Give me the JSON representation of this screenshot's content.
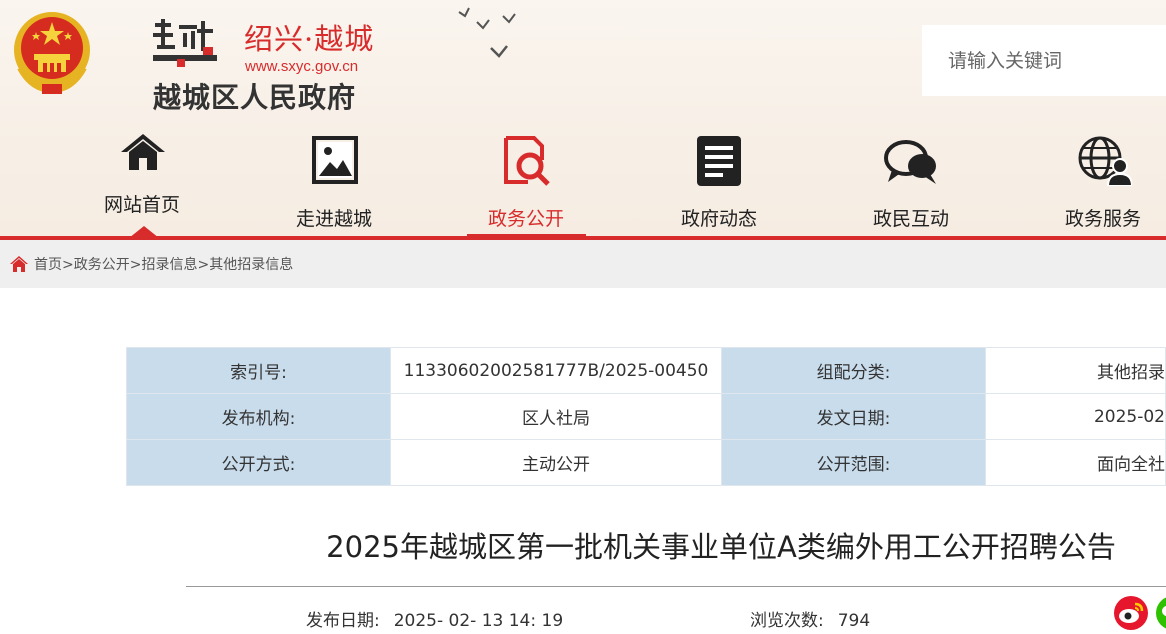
{
  "header": {
    "city_name": "绍兴·越城",
    "url": "www.sxyc.gov.cn",
    "gov_name": "越城区人民政府",
    "logo_mark_icon": "yue-calligraphy-logo",
    "search_placeholder": "请输入关键词"
  },
  "nav": {
    "items": [
      {
        "label": "网站首页",
        "icon": "home-icon"
      },
      {
        "label": "走进越城",
        "icon": "landscape-picture-icon"
      },
      {
        "label": "政务公开",
        "icon": "search-document-icon",
        "active": true
      },
      {
        "label": "政府动态",
        "icon": "news-document-icon"
      },
      {
        "label": "政民互动",
        "icon": "chat-bubbles-icon"
      },
      {
        "label": "政务服务",
        "icon": "globe-user-icon"
      }
    ]
  },
  "breadcrumb": {
    "items": [
      "首页",
      "政务公开",
      "招录信息",
      "其他招录信息"
    ],
    "separator": ">"
  },
  "meta": {
    "rows": [
      {
        "k1": "索引号:",
        "v1": "11330602002581777B/2025-00450",
        "k2": "组配分类:",
        "v2": "其他招录"
      },
      {
        "k1": "发布机构:",
        "v1": "区人社局",
        "k2": "发文日期:",
        "v2": "2025-02"
      },
      {
        "k1": "公开方式:",
        "v1": "主动公开",
        "k2": "公开范围:",
        "v2": "面向全社"
      }
    ]
  },
  "article": {
    "title": "2025年越城区第一批机关事业单位A类编外用工公开招聘公告",
    "publish_label": "发布日期:",
    "publish_date": "2025- 02- 13 14: 19",
    "views_label": "浏览次数:",
    "views": "794"
  },
  "share": {
    "weibo_icon": "weibo-icon",
    "wechat_icon": "wechat-icon"
  },
  "colors": {
    "accent": "#d82c2c",
    "label_bg": "#c9dcec",
    "crumb_bg": "#efefef"
  }
}
